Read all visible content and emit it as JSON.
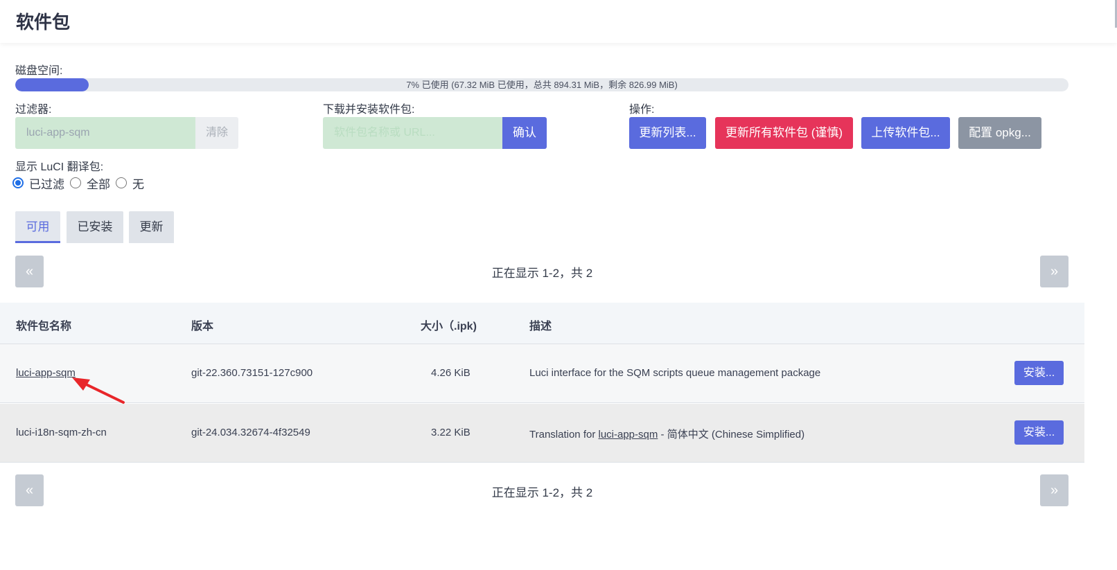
{
  "page_title": "软件包",
  "disk": {
    "label": "磁盘空间:",
    "used_percent": 7,
    "text": "7% 已使用 (67.32 MiB 已使用，总共 894.31 MiB，剩余 826.99 MiB)"
  },
  "filter": {
    "label": "过滤器:",
    "value": "luci-app-sqm",
    "clear_label": "清除"
  },
  "download": {
    "label": "下载并安装软件包:",
    "placeholder": "软件包名称或 URL...",
    "confirm_label": "确认"
  },
  "actions": {
    "label": "操作:",
    "update_lists": "更新列表...",
    "upgrade_all": "更新所有软件包 (谨慎)",
    "upload": "上传软件包...",
    "configure": "配置 opkg..."
  },
  "luci_i18n": {
    "label": "显示 LuCI 翻译包:",
    "options": [
      "已过滤",
      "全部",
      "无"
    ],
    "selected": "已过滤"
  },
  "tabs": [
    "可用",
    "已安装",
    "更新"
  ],
  "pager": {
    "prev": "«",
    "next": "»",
    "text": "正在显示 1-2，共 2"
  },
  "table": {
    "headers": [
      "软件包名称",
      "版本",
      "大小（.ipk)",
      "描述"
    ],
    "rows": [
      {
        "name": "luci-app-sqm",
        "version": "git-22.360.73151-127c900",
        "size": "4.26 KiB",
        "description": "Luci interface for the SQM scripts queue management package",
        "action": "安装..."
      },
      {
        "name": "luci-i18n-sqm-zh-cn",
        "version": "git-24.034.32674-4f32549",
        "size": "3.22 KiB",
        "description_prefix": "Translation for ",
        "description_link": "luci-app-sqm",
        "description_suffix": " - 简体中文 (Chinese Simplified)",
        "action": "安装..."
      }
    ]
  },
  "colors": {
    "accent": "#5a6bde",
    "danger": "#e6345a",
    "secondary": "#8c95a3",
    "input_bg": "#cfe8d4",
    "annotation_arrow": "#e8262a"
  }
}
